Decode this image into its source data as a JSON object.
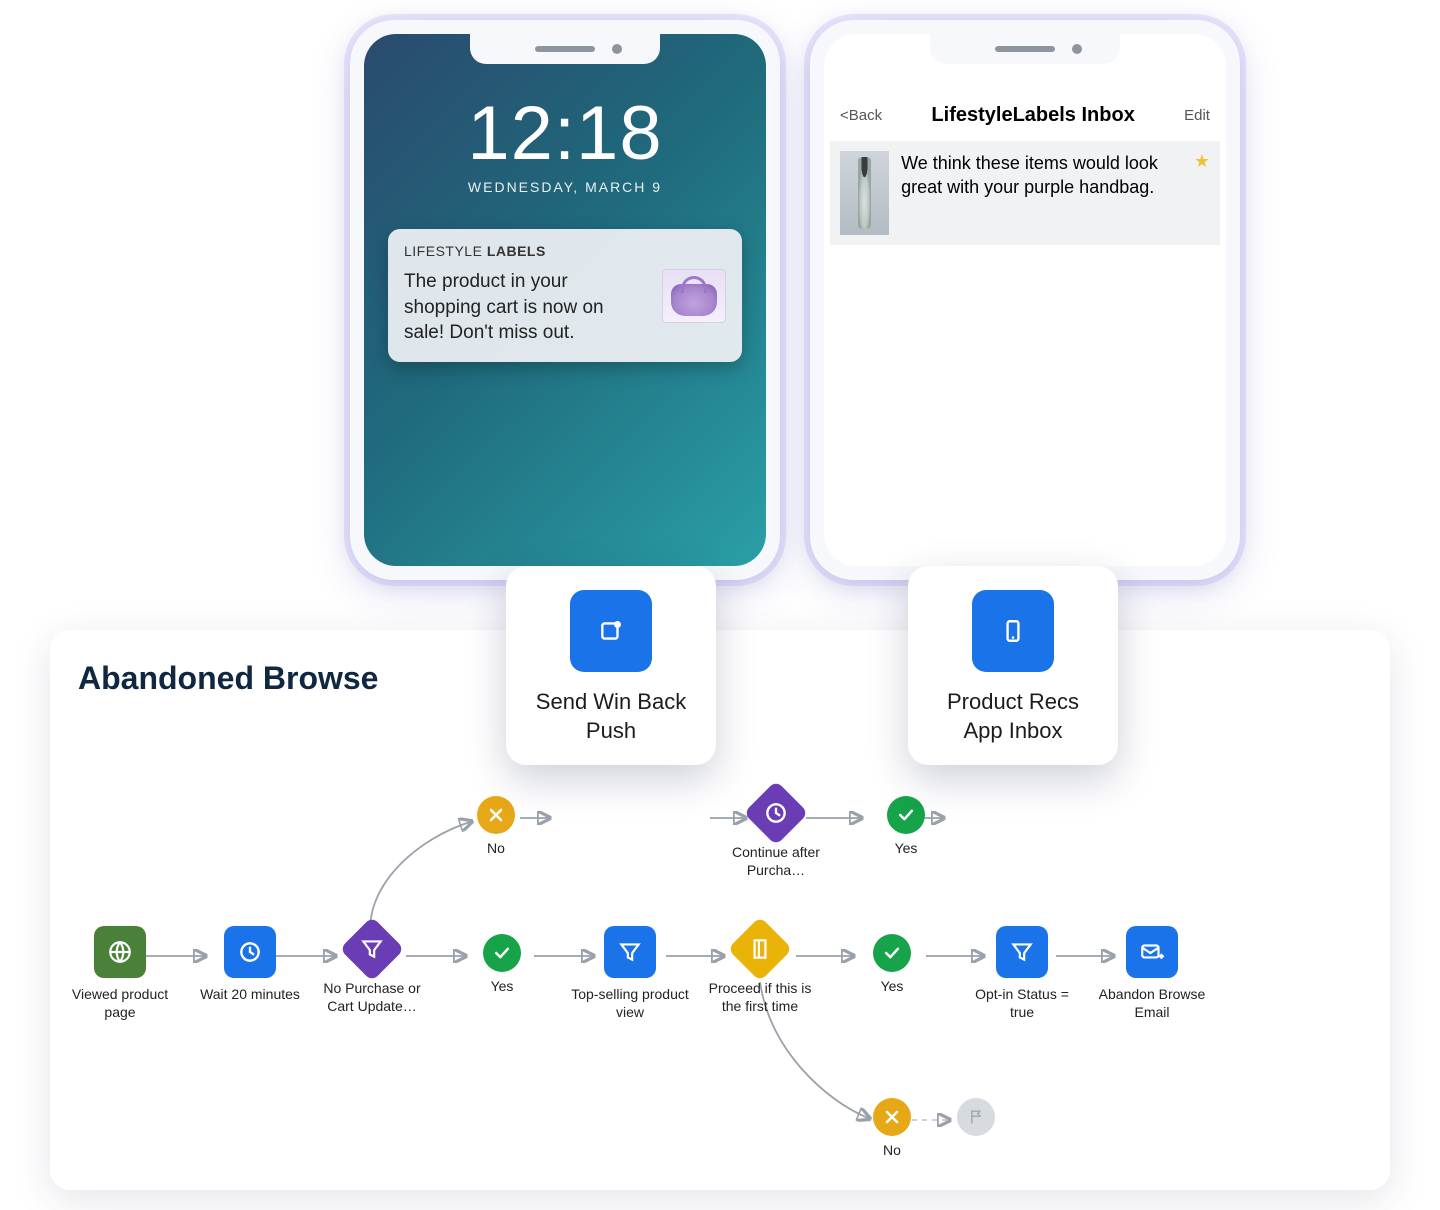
{
  "accent": "#1a73e8",
  "phoneLeft": {
    "time": "12:18",
    "date": "WEDNESDAY, MARCH 9",
    "push": {
      "brand_thin": "LIFESTYLE ",
      "brand_bold": "LABELS",
      "body": "The product in your shopping cart is now on sale! Don't miss out."
    }
  },
  "phoneRight": {
    "back": "<Back",
    "title": "LifestyleLabels Inbox",
    "edit": "Edit",
    "itemText": "We think these items would look great with your purple handbag."
  },
  "panel": {
    "title": "Abandoned Browse",
    "bigCards": [
      {
        "label": "Send Win Back Push"
      },
      {
        "label": "Product Recs App Inbox"
      }
    ],
    "nodes": {
      "n1": "Viewed product page",
      "n2": "Wait 20 minutes",
      "n3": "No Purchase or Cart Update…",
      "nNoTop": "No",
      "nContinue": "Continue after Purcha…",
      "nYesTop": "Yes",
      "nYesMid": "Yes",
      "nTopSell": "Top-selling product view",
      "nFirstTime": "Proceed if this is the first time",
      "nYesMid2": "Yes",
      "nOptIn": "Opt-in Status = true",
      "nEmail": "Abandon Browse Email",
      "nNoBottom": "No"
    }
  }
}
